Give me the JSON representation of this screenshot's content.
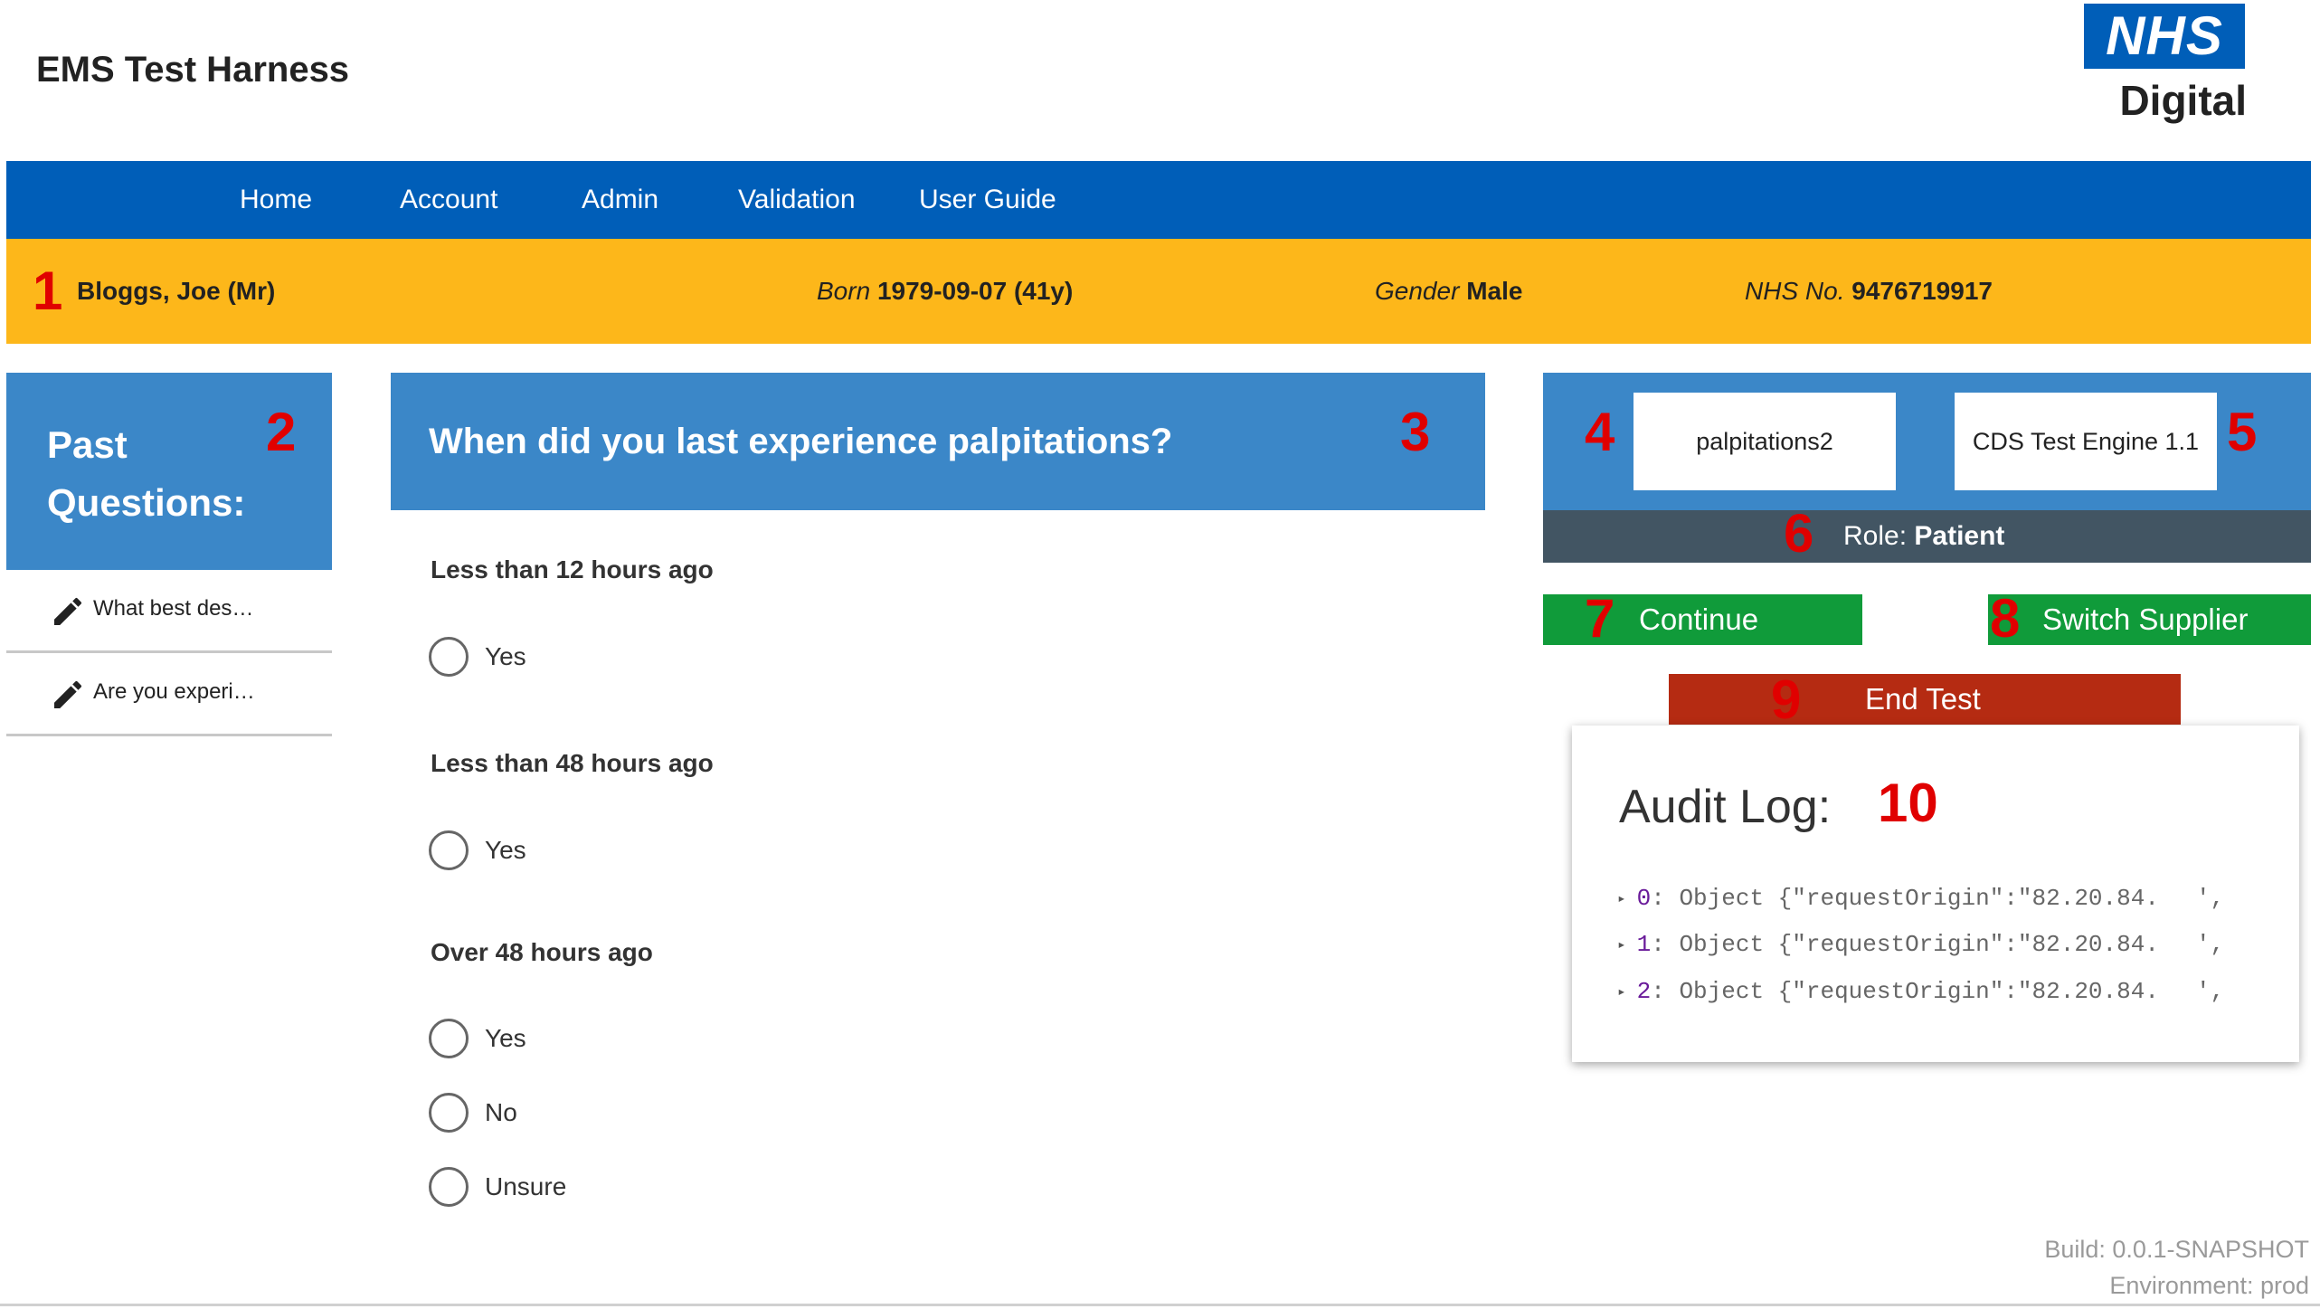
{
  "app": {
    "title": "EMS Test Harness"
  },
  "logo": {
    "line1": "NHS",
    "line2": "Digital",
    "brand_color": "#005eb8"
  },
  "nav": {
    "items": [
      "Home",
      "Account",
      "Admin",
      "Validation",
      "User Guide"
    ]
  },
  "patient": {
    "name": "Bloggs, Joe (Mr)",
    "born_label": "Born",
    "born_value": "1979-09-07 (41y)",
    "gender_label": "Gender",
    "gender_value": "Male",
    "nhs_label": "NHS No.",
    "nhs_value": "9476719917"
  },
  "past_questions": {
    "title": "Past Questions:",
    "items": [
      {
        "label": "What best des…",
        "icon": "pencil-icon"
      },
      {
        "label": "Are you experi…",
        "icon": "pencil-icon"
      }
    ]
  },
  "question": {
    "text": "When did you last experience palpitations?",
    "groups": [
      {
        "title": "Less than 12 hours ago",
        "options": [
          "Yes"
        ]
      },
      {
        "title": "Less than 48 hours ago",
        "options": [
          "Yes"
        ]
      },
      {
        "title": "Over 48 hours ago",
        "options": [
          "Yes",
          "No",
          "Unsure"
        ]
      }
    ]
  },
  "panel": {
    "service_id": "palpitations2",
    "engine": "CDS Test Engine 1.1",
    "role_label": "Role:",
    "role_value": "Patient",
    "continue_label": "Continue",
    "switch_label": "Switch Supplier",
    "end_label": "End Test"
  },
  "audit": {
    "title": "Audit Log:",
    "entries": [
      {
        "index": "0",
        "text": ": Object {\"requestOrigin\":\"82.20.84.",
        "tail": "',"
      },
      {
        "index": "1",
        "text": ": Object {\"requestOrigin\":\"82.20.84.",
        "tail": "',"
      },
      {
        "index": "2",
        "text": ": Object {\"requestOrigin\":\"82.20.84.",
        "tail": "',"
      }
    ]
  },
  "markers": [
    "1",
    "2",
    "3",
    "4",
    "5",
    "6",
    "7",
    "8",
    "9",
    "10"
  ],
  "footer": {
    "build": "Build: 0.0.1-SNAPSHOT",
    "environment": "Environment: prod"
  },
  "colors": {
    "nav_blue": "#005eb8",
    "panel_blue": "#3b87c8",
    "patient_yellow": "#fdb71a",
    "role_grey": "#425563",
    "continue_green": "#109b3a",
    "end_red": "#b52b12",
    "marker_red": "#e00000"
  }
}
